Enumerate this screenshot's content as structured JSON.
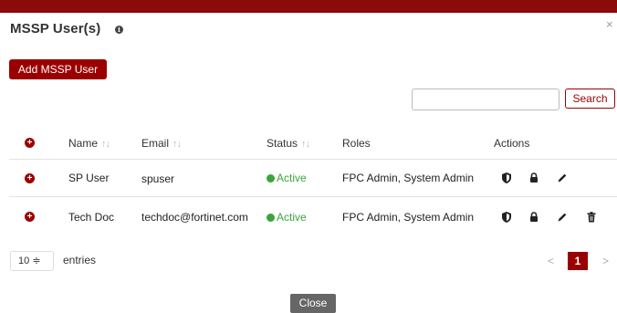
{
  "dialog": {
    "title": "MSSP User(s)",
    "close_glyph": "×",
    "accent_color": "#9b0000"
  },
  "toolbar": {
    "add_label": "Add MSSP User",
    "search_placeholder": "",
    "search_label": "Search"
  },
  "table": {
    "columns": {
      "name": "Name",
      "email": "Email",
      "status": "Status",
      "roles": "Roles",
      "actions": "Actions"
    },
    "sort_glyph": "↑↓",
    "rows": [
      {
        "name": "SP User",
        "email": "spuser",
        "status": "Active",
        "roles": "FPC Admin, System Admin",
        "actions": [
          "shield-icon",
          "lock-icon",
          "pencil-icon"
        ]
      },
      {
        "name": "Tech Doc",
        "email": "techdoc@fortinet.com",
        "status": "Active",
        "roles": "FPC Admin, System Admin",
        "actions": [
          "shield-icon",
          "lock-icon",
          "pencil-icon",
          "trash-icon"
        ]
      }
    ]
  },
  "footer": {
    "page_size": "10",
    "page_size_arrow": "≑",
    "entries_label": "entries",
    "prev": "<",
    "current_page": "1",
    "next": ">",
    "close_label": "Close"
  }
}
